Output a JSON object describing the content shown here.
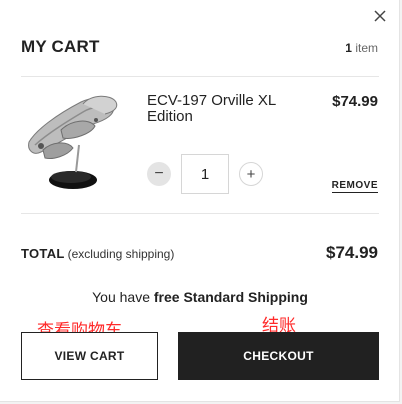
{
  "cart": {
    "title": "MY CART",
    "item_count": "1",
    "item_count_suffix": " item"
  },
  "item": {
    "name": "ECV-197 Orville XL Edition",
    "price": "$74.99",
    "quantity": "1",
    "minus_label": "−",
    "plus_label": "+",
    "remove_label": "REMOVE",
    "image_icon": "starship-model-image"
  },
  "totals": {
    "label": "TOTAL",
    "sublabel": "(excluding shipping)",
    "value": "$74.99"
  },
  "shipping": {
    "prefix": "You have ",
    "highlight": "free Standard Shipping"
  },
  "annotations": {
    "view_cart_note": "查看购物车",
    "checkout_note": "结账",
    "color": "#ff2a2a"
  },
  "buttons": {
    "view_cart": "VIEW CART",
    "checkout": "CHECKOUT"
  },
  "colors": {
    "checkout_bg": "#212121",
    "text": "#222222",
    "divider": "#e6e6e6"
  }
}
